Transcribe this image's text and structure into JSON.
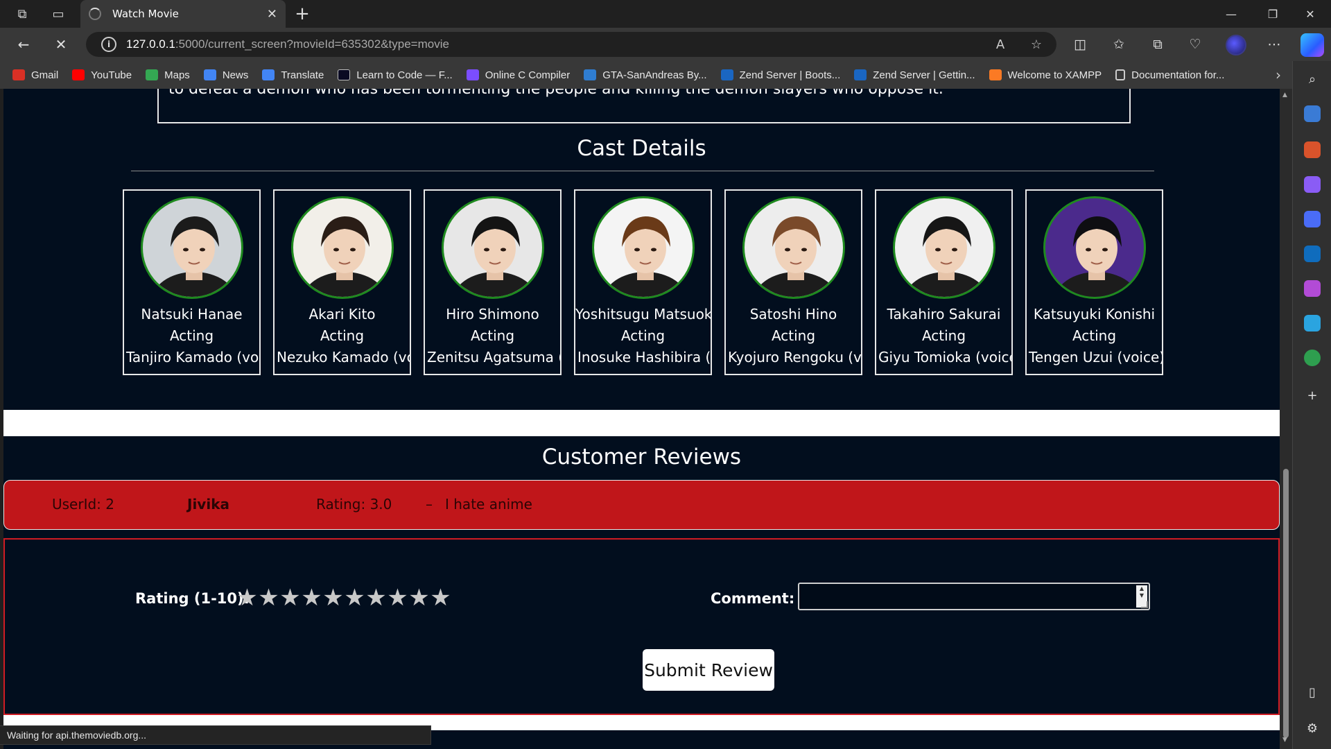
{
  "browser": {
    "tab_title": "Watch Movie",
    "url_host": "127.0.0.1",
    "url_rest": ":5000/current_screen?movieId=635302&type=movie",
    "bookmarks": [
      {
        "label": "Gmail",
        "color": "#d93025"
      },
      {
        "label": "YouTube",
        "color": "#ff0000"
      },
      {
        "label": "Maps",
        "color": "#34a853"
      },
      {
        "label": "News",
        "color": "#4285f4"
      },
      {
        "label": "Translate",
        "color": "#4285f4"
      },
      {
        "label": "Learn to Code — F...",
        "color": "#0a0a23"
      },
      {
        "label": "Online C Compiler",
        "color": "#7b4dff"
      },
      {
        "label": "GTA-SanAndreas By...",
        "color": "#2f7dd1"
      },
      {
        "label": "Zend Server | Boots...",
        "color": "#1a66c2"
      },
      {
        "label": "Zend Server | Gettin...",
        "color": "#1a66c2"
      },
      {
        "label": "Welcome to XAMPP",
        "color": "#fb7a24"
      },
      {
        "label": "Documentation for...",
        "color": "#cccccc"
      }
    ],
    "status_text": "Waiting for api.themoviedb.org..."
  },
  "overview": {
    "text_fragment": "to defeat a demon who has been tormenting the people and killing the demon slayers who oppose it."
  },
  "cast": {
    "title": "Cast Details",
    "members": [
      {
        "name": "Natsuki Hanae",
        "department": "Acting",
        "character": "Tanjiro Kamado (voice)",
        "photo_bg": "#cfd4d8",
        "hair": "#1b1b1b"
      },
      {
        "name": "Akari Kito",
        "department": "Acting",
        "character": "Nezuko Kamado (voice)",
        "photo_bg": "#f2efe9",
        "hair": "#2a1d16"
      },
      {
        "name": "Hiro Shimono",
        "department": "Acting",
        "character": "Zenitsu Agatsuma (voice)",
        "photo_bg": "#e7e7e7",
        "hair": "#141414"
      },
      {
        "name": "Yoshitsugu Matsuoka",
        "department": "Acting",
        "character": "Inosuke Hashibira (voice)",
        "photo_bg": "#f4f4f4",
        "hair": "#6a3a18"
      },
      {
        "name": "Satoshi Hino",
        "department": "Acting",
        "character": "Kyojuro Rengoku (voice)",
        "photo_bg": "#ededed",
        "hair": "#7a4a2a"
      },
      {
        "name": "Takahiro Sakurai",
        "department": "Acting",
        "character": "Giyu Tomioka (voice)",
        "photo_bg": "#f0f0f0",
        "hair": "#161616"
      },
      {
        "name": "Katsuyuki Konishi",
        "department": "Acting",
        "character": "Tengen Uzui (voice)",
        "photo_bg": "#4b2a8c",
        "hair": "#0e0e12"
      }
    ]
  },
  "reviews": {
    "title": "Customer Reviews",
    "items": [
      {
        "user_id": "UserId: 2",
        "name": "Jivika",
        "rating": "Rating: 3.0",
        "separator": "–",
        "comment": "I hate anime"
      }
    ]
  },
  "review_form": {
    "rating_label": "Rating (1-10):",
    "star_count": 10,
    "star_glyph": "★",
    "comment_label": "Comment:",
    "comment_value": "",
    "submit_label": "Submit Review"
  }
}
